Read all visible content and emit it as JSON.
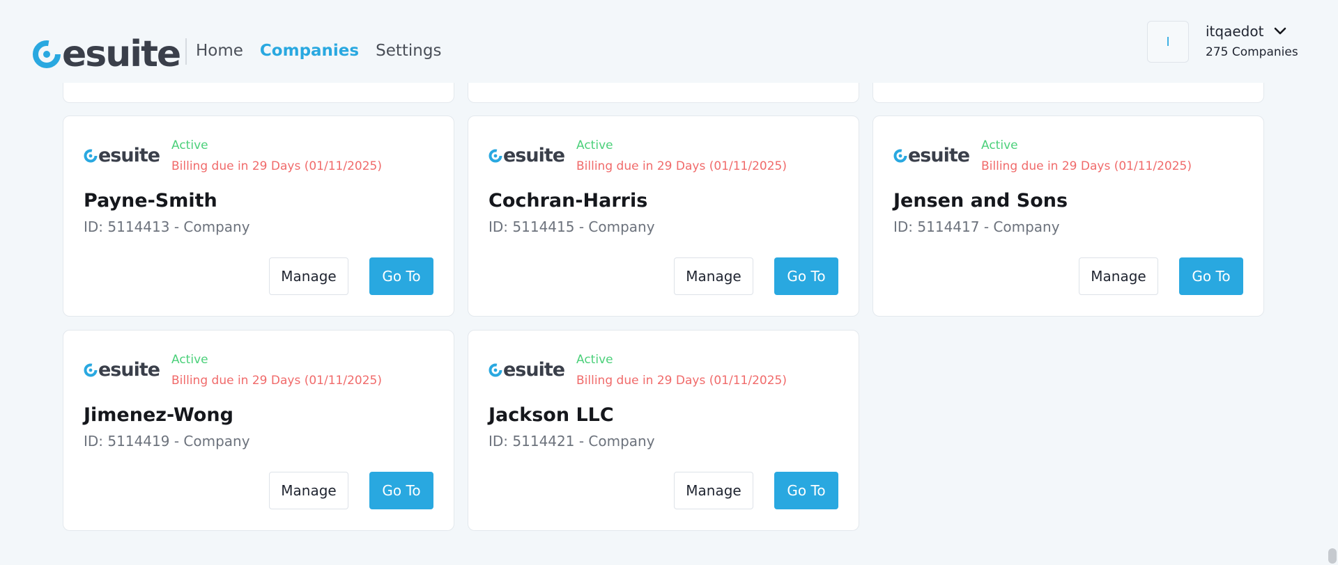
{
  "brand": {
    "name": "esuite",
    "accent": "#29a8e0"
  },
  "nav": {
    "items": [
      {
        "label": "Home",
        "active": false
      },
      {
        "label": "Companies",
        "active": true
      },
      {
        "label": "Settings",
        "active": false
      }
    ]
  },
  "user": {
    "avatar_initial": "I",
    "name": "itqaedot",
    "companies_count": "275 Companies"
  },
  "companies": [
    {
      "name": "Payne-Smith",
      "id_text": "ID: 5114413 - Company",
      "status": "Active",
      "billing": "Billing due in 29 Days (01/11/2025)",
      "manage_label": "Manage",
      "goto_label": "Go To"
    },
    {
      "name": "Cochran-Harris",
      "id_text": "ID: 5114415 - Company",
      "status": "Active",
      "billing": "Billing due in 29 Days (01/11/2025)",
      "manage_label": "Manage",
      "goto_label": "Go To"
    },
    {
      "name": "Jensen and Sons",
      "id_text": "ID: 5114417 - Company",
      "status": "Active",
      "billing": "Billing due in 29 Days (01/11/2025)",
      "manage_label": "Manage",
      "goto_label": "Go To"
    },
    {
      "name": "Jimenez-Wong",
      "id_text": "ID: 5114419 - Company",
      "status": "Active",
      "billing": "Billing due in 29 Days (01/11/2025)",
      "manage_label": "Manage",
      "goto_label": "Go To"
    },
    {
      "name": "Jackson LLC",
      "id_text": "ID: 5114421 - Company",
      "status": "Active",
      "billing": "Billing due in 29 Days (01/11/2025)",
      "manage_label": "Manage",
      "goto_label": "Go To"
    }
  ],
  "colors": {
    "active": "#4bd07a",
    "billing": "#f06a6a",
    "button": "#29a8e0"
  }
}
